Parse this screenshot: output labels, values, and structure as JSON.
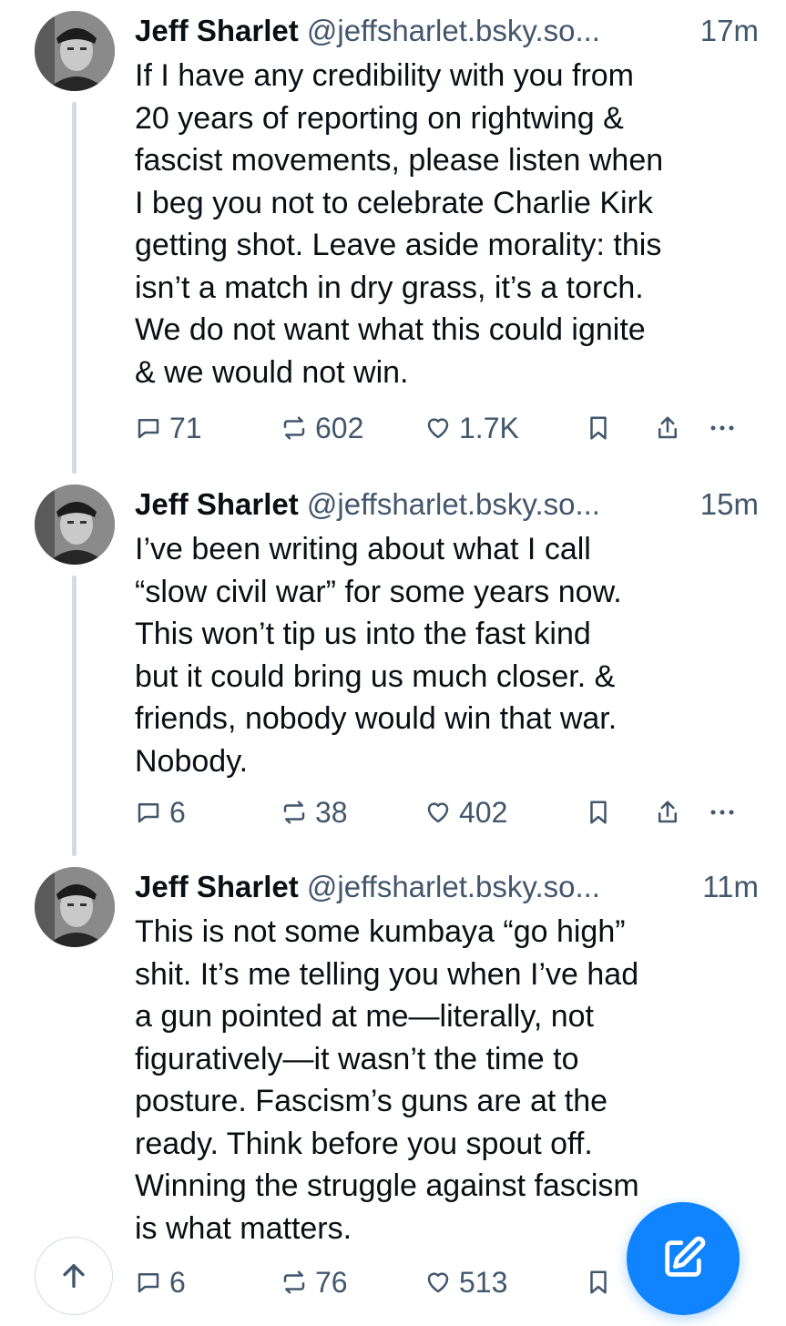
{
  "posts": [
    {
      "author": "Jeff Sharlet",
      "handle": "@jeffsharlet.bsky.so...",
      "time": "17m",
      "text": "If I have any credibility with you from\n20 years of reporting on rightwing &\nfascist movements, please listen when\nI beg you not to celebrate Charlie Kirk\ngetting shot. Leave aside morality: this\nisn’t a match in dry grass, it’s a torch.\nWe do not want what this could ignite\n& we would not win.",
      "replies": "71",
      "reposts": "602",
      "likes": "1.7K"
    },
    {
      "author": "Jeff Sharlet",
      "handle": "@jeffsharlet.bsky.so...",
      "time": "15m",
      "text": "I’ve been writing about what I call\n“slow civil war” for some years now.\nThis won’t tip us into the fast kind\nbut it could bring us much closer. &\nfriends, nobody would win that war.\nNobody.",
      "replies": "6",
      "reposts": "38",
      "likes": "402"
    },
    {
      "author": "Jeff Sharlet",
      "handle": "@jeffsharlet.bsky.so...",
      "time": "11m",
      "text": "This is not some kumbaya “go high”\nshit. It’s me telling you when I’ve had\na gun pointed at me—literally, not\nfiguratively—it wasn’t the time to\nposture. Fascism’s guns are at the\nready. Think before you spout off.\nWinning the struggle against fascism\nis what matters.",
      "replies": "6",
      "reposts": "76",
      "likes": "513"
    }
  ],
  "icons": {
    "reply": "speech-bubble-icon",
    "repost": "repost-arrows-icon",
    "like": "heart-icon",
    "bookmark": "bookmark-icon",
    "share": "share-upload-icon",
    "more": "ellipsis-icon",
    "scroll_top": "arrow-up-icon",
    "compose": "compose-pencil-icon"
  },
  "colors": {
    "accent": "#1083fe",
    "muted": "#42576c",
    "thread_line": "#d4dbe2"
  }
}
